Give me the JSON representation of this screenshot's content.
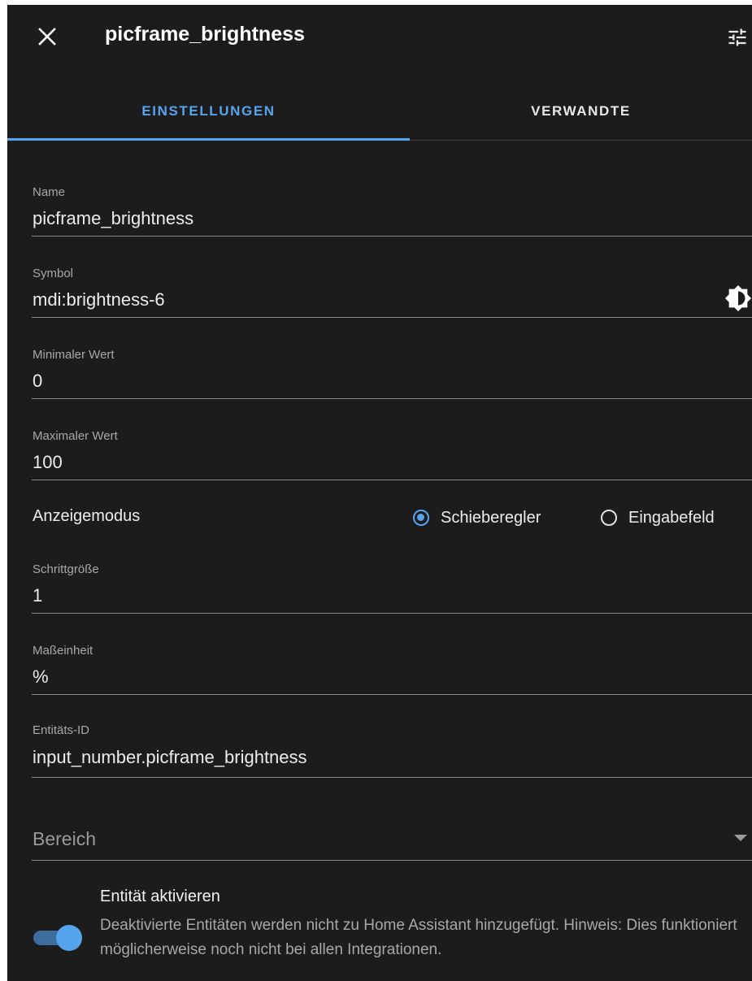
{
  "header": {
    "title": "picframe_brightness"
  },
  "tabs": [
    {
      "label": "EINSTELLUNGEN",
      "active": true
    },
    {
      "label": "VERWANDTE",
      "active": false
    }
  ],
  "form": {
    "name": {
      "label": "Name",
      "value": "picframe_brightness"
    },
    "symbol": {
      "label": "Symbol",
      "value": "mdi:brightness-6",
      "icon": "brightness-6-icon"
    },
    "min": {
      "label": "Minimaler Wert",
      "value": "0"
    },
    "max": {
      "label": "Maximaler Wert",
      "value": "100"
    },
    "mode": {
      "label": "Anzeigemodus",
      "options": [
        {
          "label": "Schieberegler",
          "checked": true
        },
        {
          "label": "Eingabefeld",
          "checked": false
        }
      ]
    },
    "step": {
      "label": "Schrittgröße",
      "value": "1"
    },
    "unit": {
      "label": "Maßeinheit",
      "value": "%"
    },
    "entity_id": {
      "label": "Entitäts-ID",
      "value": "input_number.picframe_brightness"
    },
    "area": {
      "placeholder": "Bereich"
    },
    "enable": {
      "title": "Entität aktivieren",
      "description": "Deaktivierte Entitäten werden nicht zu Home Assistant hinzugefügt. Hinweis: Dies funktioniert möglicherweise noch nicht bei allen Integrationen.",
      "enabled": true
    }
  },
  "colors": {
    "background": "#1c1c1c",
    "accent": "#56a3ee",
    "text": "#e1e1e1",
    "secondary_text": "#a8a8a8"
  }
}
